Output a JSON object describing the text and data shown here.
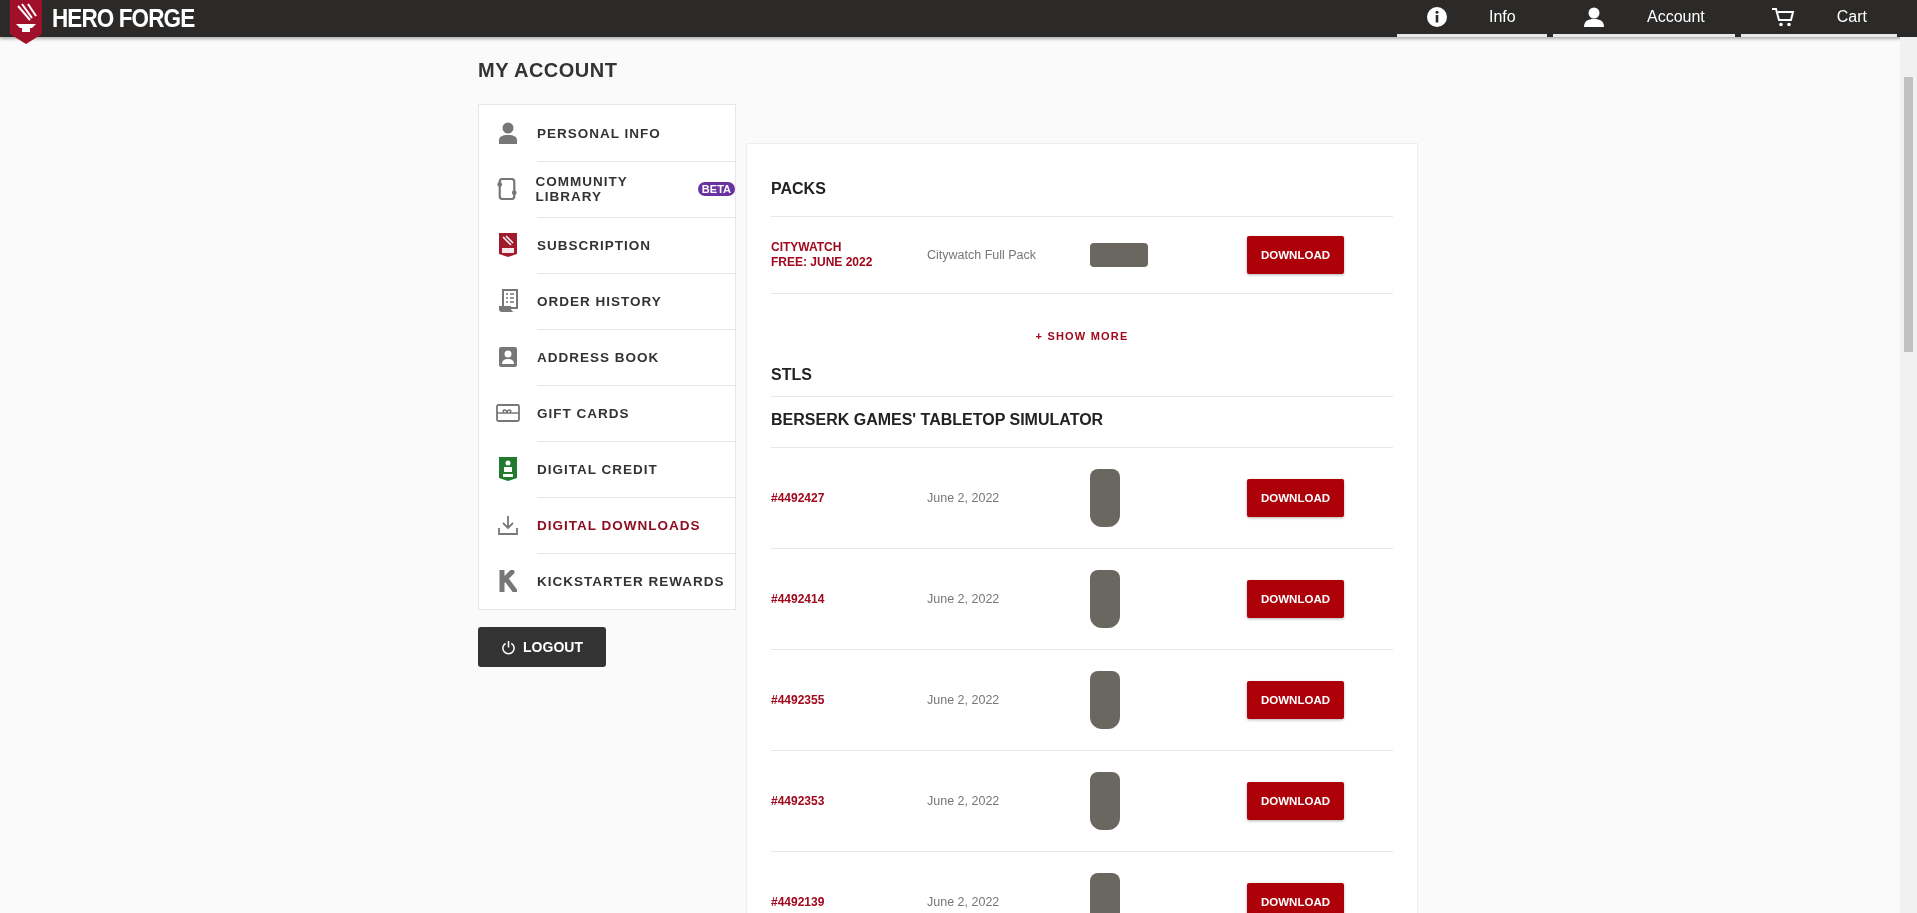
{
  "header": {
    "logo": "HERO FORGE",
    "nav": [
      {
        "label": "Info"
      },
      {
        "label": "Account"
      },
      {
        "label": "Cart"
      }
    ]
  },
  "page_title": "MY ACCOUNT",
  "sidebar": {
    "items": [
      {
        "label": "PERSONAL INFO",
        "selected": false
      },
      {
        "label": "COMMUNITY LIBRARY",
        "badge": "BETA",
        "selected": false
      },
      {
        "label": "SUBSCRIPTION",
        "selected": false
      },
      {
        "label": "ORDER HISTORY",
        "selected": false
      },
      {
        "label": "ADDRESS BOOK",
        "selected": false
      },
      {
        "label": "GIFT CARDS",
        "selected": false
      },
      {
        "label": "DIGITAL CREDIT",
        "selected": false
      },
      {
        "label": "DIGITAL DOWNLOADS",
        "selected": true
      },
      {
        "label": "KICKSTARTER REWARDS",
        "selected": false
      }
    ],
    "logout": "LOGOUT"
  },
  "packs": {
    "heading": "PACKS",
    "rows": [
      {
        "name": [
          "CITYWATCH",
          "FREE: JUNE 2022"
        ],
        "description": "Citywatch Full Pack",
        "button": "DOWNLOAD"
      }
    ],
    "show_more": "+ SHOW MORE"
  },
  "stls": {
    "heading": "STLS",
    "group": "BERSERK GAMES' TABLETOP SIMULATOR",
    "rows": [
      {
        "order": "#4492427",
        "date": "June 2, 2022",
        "button": "DOWNLOAD"
      },
      {
        "order": "#4492414",
        "date": "June 2, 2022",
        "button": "DOWNLOAD"
      },
      {
        "order": "#4492355",
        "date": "June 2, 2022",
        "button": "DOWNLOAD"
      },
      {
        "order": "#4492353",
        "date": "June 2, 2022",
        "button": "DOWNLOAD"
      },
      {
        "order": "#4492139",
        "date": "June 2, 2022",
        "button": "DOWNLOAD"
      }
    ]
  }
}
